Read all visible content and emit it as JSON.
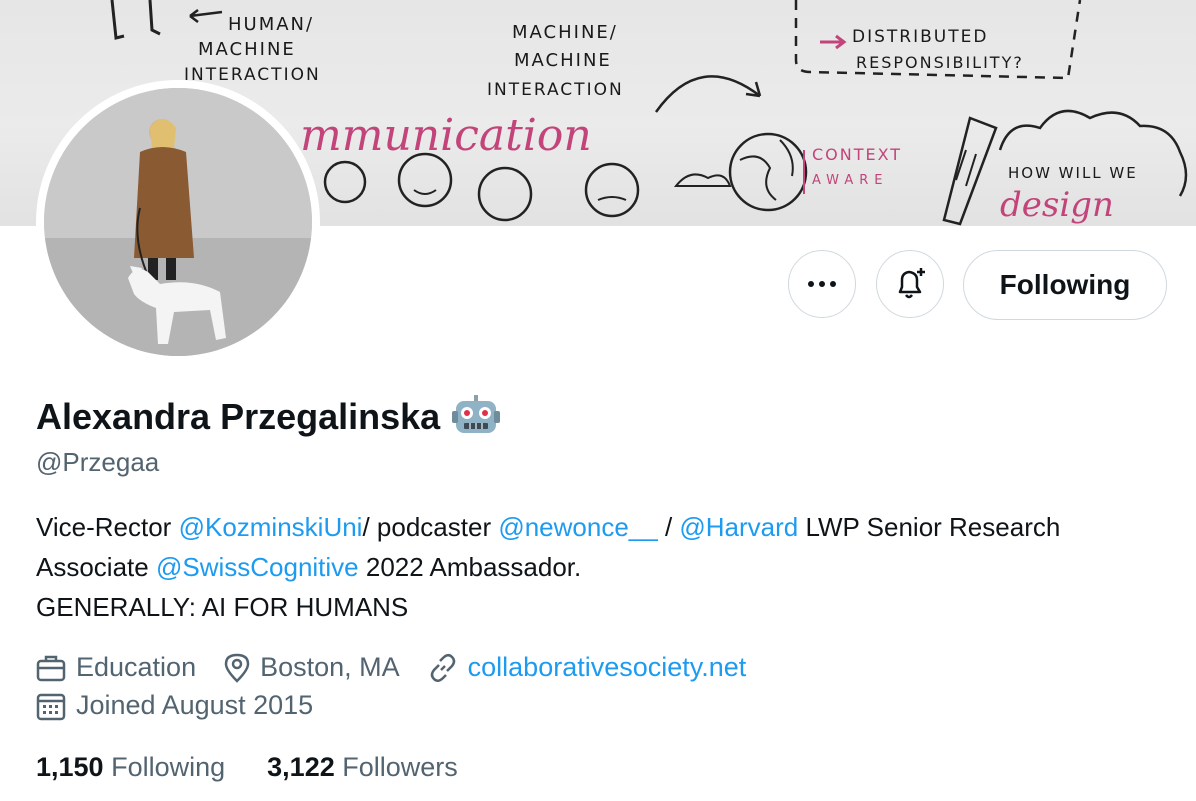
{
  "banner": {
    "labels": {
      "human_machine_1": "HUMAN/",
      "human_machine_2": "MACHINE",
      "human_machine_3": "INTERACTION",
      "machine_machine_1": "MACHINE/",
      "machine_machine_2": "MACHINE",
      "machine_machine_3": "INTERACTION",
      "distributed_1": "DISTRIBUTED",
      "distributed_2": "RESPONSIBILITY?",
      "communication": "mmunication",
      "context_1": "CONTEXT",
      "context_2": "AWARE",
      "how_will_we": "HOW WILL WE",
      "design": "design"
    }
  },
  "profile": {
    "name": "Alexandra Przegalinska",
    "handle": "@Przegaa",
    "bio": {
      "p1": "Vice-Rector ",
      "m1": "@KozminskiUni",
      "p2": "/ podcaster ",
      "m2": "@newonce__",
      "p3": " / ",
      "m3": "@Harvard",
      "p4": " LWP Senior Research Associate ",
      "m4": "@SwissCognitive",
      "p5": " 2022 Ambassador.",
      "line2": "GENERALLY: AI FOR HUMANS"
    },
    "category": "Education",
    "location": "Boston, MA",
    "website": "collaborativesociety.net",
    "joined": "Joined August 2015",
    "following_count": "1,150",
    "following_label": "Following",
    "followers_count": "3,122",
    "followers_label": "Followers"
  },
  "actions": {
    "follow_button_label": "Following"
  },
  "icons": {
    "more": "more-icon",
    "bell": "bell-plus-icon",
    "robot": "robot-emoji-icon",
    "briefcase": "briefcase-icon",
    "location": "location-pin-icon",
    "link": "link-icon",
    "calendar": "calendar-icon"
  },
  "colors": {
    "link": "#1d9bf0",
    "secondary_text": "#536471",
    "primary_text": "#0f1419",
    "border": "#cfd9de"
  }
}
